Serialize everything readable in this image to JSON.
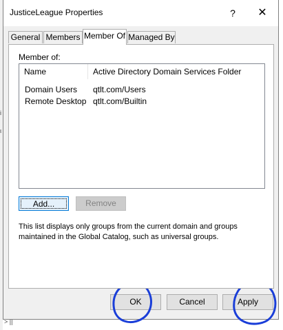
{
  "window": {
    "title": "JusticeLeague Properties",
    "help_glyph": "?",
    "close_glyph": "✕"
  },
  "tabs": [
    {
      "label": "General"
    },
    {
      "label": "Members"
    },
    {
      "label": "Member Of",
      "active": true
    },
    {
      "label": "Managed By"
    }
  ],
  "member_of": {
    "section_label": "Member of:",
    "columns": [
      "Name",
      "Active Directory Domain Services Folder"
    ],
    "rows": [
      {
        "name": "Domain Users",
        "folder": "qtlt.com/Users"
      },
      {
        "name": "Remote Desktop ...",
        "folder": "qtlt.com/Builtin"
      }
    ],
    "add_label": "Add...",
    "remove_label": "Remove",
    "info_text": "This list displays only groups from the current domain and groups maintained in the Global Catalog, such as universal groups."
  },
  "footer": {
    "ok_label": "OK",
    "cancel_label": "Cancel",
    "apply_label": "Apply"
  },
  "colors": {
    "annotation_ink": "#1a3ed8",
    "focus_border": "#0078d7",
    "dialog_bg": "#f0f0f0"
  }
}
